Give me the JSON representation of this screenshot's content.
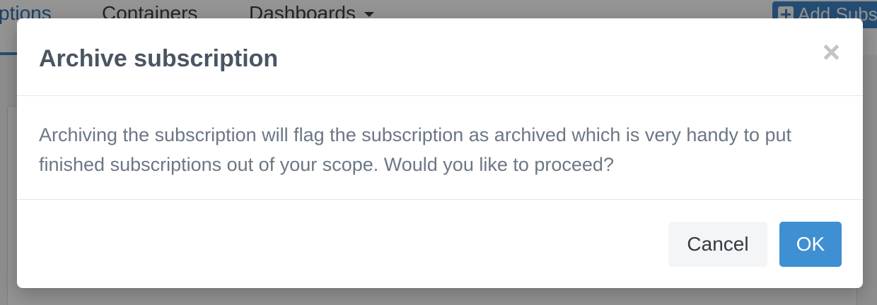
{
  "background": {
    "nav_tabs": [
      {
        "label": "ptions"
      },
      {
        "label": "Containers"
      },
      {
        "label": "Dashboards"
      }
    ],
    "add_button_label": "Add Subs"
  },
  "modal": {
    "title": "Archive subscription",
    "close_icon": "close-icon",
    "message": "Archiving the subscription will flag the subscription as archived which is very handy to put finished subscriptions out of your scope. Would you like to proceed?",
    "buttons": {
      "cancel_label": "Cancel",
      "ok_label": "OK"
    }
  },
  "colors": {
    "primary": "#3f8fd3",
    "title_text": "#4a5562",
    "body_text": "#6b7785"
  }
}
